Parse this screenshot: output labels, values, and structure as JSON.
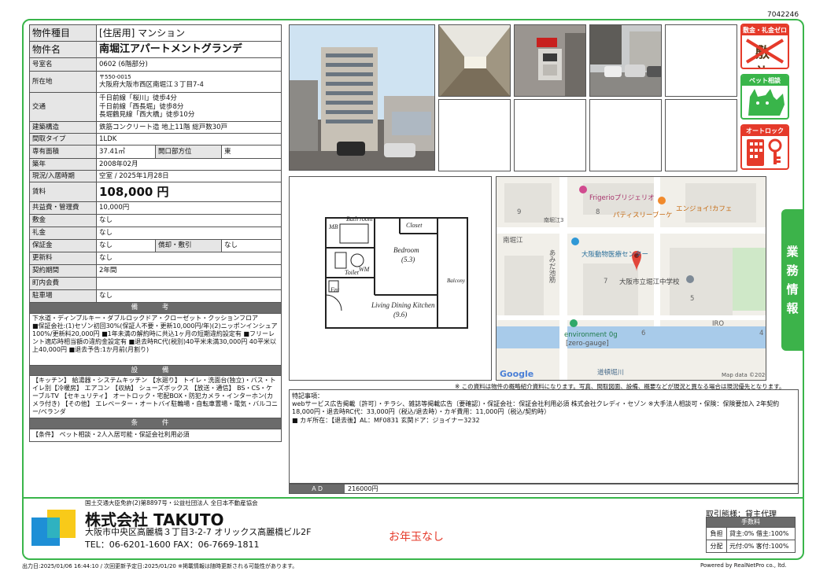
{
  "doc_id": "7042246",
  "spec": {
    "property_type": {
      "k": "物件種目",
      "v": "[住居用] マンション"
    },
    "name": {
      "k": "物件名",
      "v": "南堀江アパートメントグランデ"
    },
    "room": {
      "k": "号室名",
      "v": "0602 (6階部分)"
    },
    "address": {
      "k": "所在地",
      "zip": "〒550-0015",
      "v": "大阪府大阪市西区南堀江３丁目7-4"
    },
    "access": {
      "k": "交通",
      "lines": [
        "千日前線「桜川」徒歩4分",
        "千日前線「西長堀」徒歩8分",
        "長堀鶴見線「西大橋」徒歩10分"
      ]
    },
    "structure": {
      "k": "建築構造",
      "v": "鉄筋コンクリート造 地上11階 総戸数30戸"
    },
    "layout": {
      "k": "間取タイプ",
      "v": "1LDK"
    },
    "area": {
      "k": "専有面積",
      "v": "37.41㎡",
      "k2": "開口部方位",
      "v2": "東"
    },
    "built": {
      "k": "築年",
      "v": "2008年02月"
    },
    "status": {
      "k": "現況/入居時期",
      "v": "空室 / 2025年1月28日"
    },
    "rent": {
      "k": "賃料",
      "v": "108,000 円"
    },
    "common_fee": {
      "k": "共益費・管理費",
      "v": "10,000円"
    },
    "deposit": {
      "k": "敷金",
      "v": "なし"
    },
    "key_money": {
      "k": "礼金",
      "v": "なし"
    },
    "guarantee": {
      "k": "保証金",
      "v": "なし",
      "k2": "償却・敷引",
      "v2": "なし"
    },
    "renewal": {
      "k": "更新料",
      "v": "なし"
    },
    "contract": {
      "k": "契約期間",
      "v": "2年間"
    },
    "town_fee": {
      "k": "町内会費",
      "v": ""
    },
    "parking": {
      "k": "駐車場",
      "v": "なし"
    }
  },
  "remarks": {
    "title": "備 考",
    "text": "下水道・ディンプルキー・ダブルロックドア・クローゼット・クッションフロア\n■保証会社:(1)セゾン初回30%(保証人不要・更新10,000円/年)(2)ニッポンインシュア100%/更新料20,000円 ■1年未満の解約時に共込1ヶ月の短期違約設定有 ■フリーレント適応時相当額の違約金設定有 ■退去時RC代(税別)40平米未満30,000円 40平米以上40,000円 ■退去予告:1か月前(月割り)"
  },
  "facilities": {
    "title": "設 備",
    "text": "【キッチン】 給湯器・システムキッチン 【水廻り】 トイレ・洗面台(独立)・バス・トイレ別【冷暖房】 エアコン 【収納】 シューズボックス 【放送・通信】 BS・CS・ケーブルTV 【セキュリティ】 オートロック・宅配BOX・防犯カメラ・インターホン(カメラ付き) 【その他】 エレベーター・オートバイ駐輪場・自転車置場・電気・バルコニー/ベランダ"
  },
  "conditions": {
    "title": "条 件",
    "text": "【条件】 ペット相談・2人入居可能・保証会社利用必須"
  },
  "badges": {
    "zero": {
      "label": "敷金・礼金ゼロ",
      "sub": "敷 礼"
    },
    "pet": {
      "label": "ペット相談"
    },
    "lock": {
      "label": "オートロック"
    }
  },
  "side_tab": [
    "業",
    "務",
    "情",
    "報"
  ],
  "floorplan": {
    "mb": "MB",
    "bath": "Bath room",
    "closet": "Closet",
    "wm": "WM",
    "bedroom": "Bedroom",
    "bedroom_size": "(5.3)",
    "toilet": "Toilet",
    "ent": "Ent",
    "balcony": "Balcony",
    "ldk": "Living Dining Kitchen",
    "ldk_size": "(9.6)"
  },
  "map": {
    "labels": [
      "Frigerioプリジェリオ",
      "パティスリーブーケ",
      "エンジョイ!カフェ",
      "南堀江",
      "大阪動物医療センター",
      "大阪市立堀江中学校",
      "environment 0g",
      "[zero-gauge]",
      "道頓堀川",
      "IRO",
      "あみだ池筋",
      "南堀江3"
    ],
    "blocks": [
      "8",
      "9",
      "7",
      "6",
      "5",
      "4"
    ],
    "google": "Google",
    "credit": "Map data ©2020"
  },
  "disclaimer": "※ この資料は物件の概略紹介資料になります。写真、間取図面、設備、概要などが現況と異なる場合は現況優先となります。",
  "notes": {
    "title": "特記事項：",
    "text": "webサービス広告掲載〔許可〕・チラシ、雑誌等掲載広告〔要確認〕・保証会社：保証会社利用必須 株式会社クレディ・セゾン ※大手法人相談可・保険：保険要加入 2年契約 18,000円・退去時RC代：33,000円（税込/退去時）・カギ費用：11,000円（税込/契約時）\n■ カギ所在：【退去後】AL：MF0831 玄関ドア：ジョイナー3232"
  },
  "ad": {
    "label": "ＡＤ",
    "value": "216000円"
  },
  "company": {
    "license": "国土交通大臣免許(2)第8897号・公益社団法人 全日本不動産協会",
    "name": "株式会社 TAKUTO",
    "address": "大阪市中央区高麗橋３丁目3-2-7 オリックス高麗橋ビル2F",
    "tel": "TEL：06-6201-1600 FAX：06-7669-1811"
  },
  "promo": "お年玉なし",
  "transaction": {
    "title": "取引態様：貸主代理",
    "fee_header": "手数料",
    "rows": [
      {
        "k": "負担",
        "v": "貸主:0% 借主:100%"
      },
      {
        "k": "分配",
        "v": "元付:0% 客付:100%"
      }
    ]
  },
  "footer": {
    "left": "出力日:2025/01/06 16:44:10 / 次回更新予定日:2025/01/20 ※掲載情報は随時更新される可能性があります。",
    "right": "Powered by RealNetPro co., ltd."
  },
  "colors": {
    "green": "#39b54a",
    "red": "#e53a2a",
    "logo_blue": "#1e8fd6",
    "logo_yellow": "#f7c400"
  }
}
